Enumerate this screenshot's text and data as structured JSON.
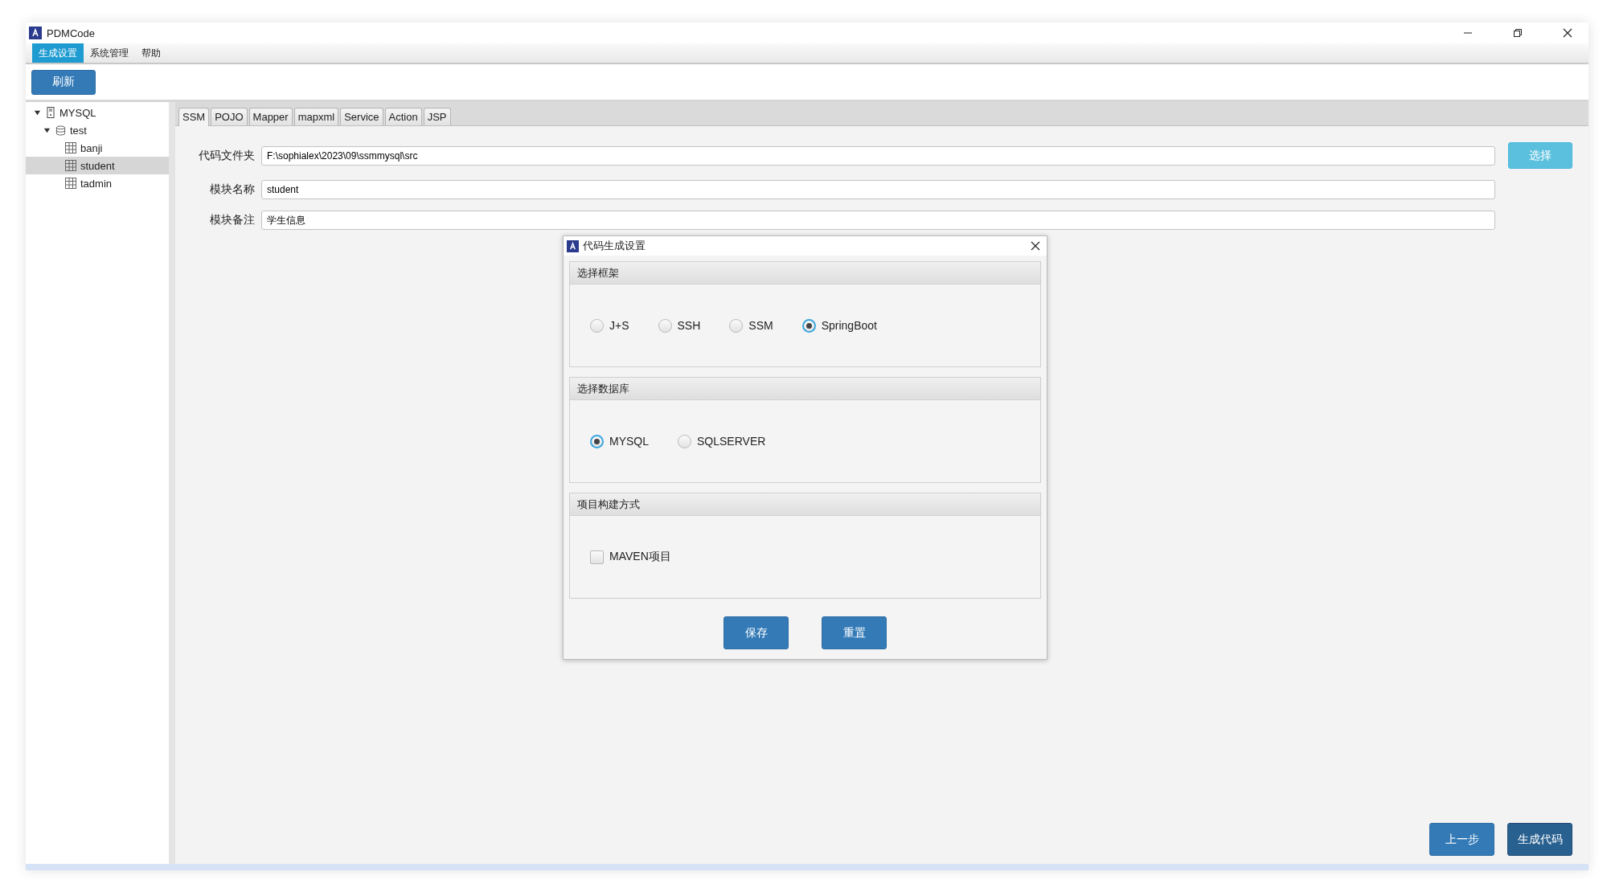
{
  "window": {
    "title": "PDMCode"
  },
  "menu": [
    {
      "label": "生成设置",
      "selected": true
    },
    {
      "label": "系统管理",
      "selected": false
    },
    {
      "label": "帮助",
      "selected": false
    }
  ],
  "toolbar": {
    "refresh_button": "刷新"
  },
  "tree": [
    {
      "label": "MYSQL",
      "kind": "server",
      "expanded": true,
      "selected": false,
      "children": [
        {
          "label": "test",
          "kind": "database",
          "expanded": true,
          "selected": false,
          "children": [
            {
              "label": "banji",
              "kind": "table",
              "selected": false
            },
            {
              "label": "student",
              "kind": "table",
              "selected": true
            },
            {
              "label": "tadmin",
              "kind": "table",
              "selected": false
            }
          ]
        }
      ]
    }
  ],
  "tabs": [
    {
      "label": "SSM",
      "selected": true
    },
    {
      "label": "POJO",
      "selected": false
    },
    {
      "label": "Mapper",
      "selected": false
    },
    {
      "label": "mapxml",
      "selected": false
    },
    {
      "label": "Service",
      "selected": false
    },
    {
      "label": "Action",
      "selected": false
    },
    {
      "label": "JSP",
      "selected": false
    }
  ],
  "form": {
    "fields": [
      {
        "label": "代码文件夹",
        "value": "F:\\sophialex\\2023\\09\\ssmmysql\\src"
      },
      {
        "label": "模块名称",
        "value": "student"
      },
      {
        "label": "模块备注",
        "value": "学生信息"
      }
    ],
    "choose_button": "选择"
  },
  "dialog": {
    "title": "代码生成设置",
    "sections": [
      {
        "title": "选择框架",
        "kind": "radio",
        "options": [
          {
            "label": "J+S",
            "selected": false
          },
          {
            "label": "SSH",
            "selected": false
          },
          {
            "label": "SSM",
            "selected": false
          },
          {
            "label": "SpringBoot",
            "selected": true
          }
        ]
      },
      {
        "title": "选择数据库",
        "kind": "radio",
        "options": [
          {
            "label": "MYSQL",
            "selected": true
          },
          {
            "label": "SQLSERVER",
            "selected": false
          }
        ]
      },
      {
        "title": "项目构建方式",
        "kind": "checkbox",
        "options": [
          {
            "label": "MAVEN项目",
            "checked": false
          }
        ]
      }
    ],
    "buttons": [
      "保存",
      "重置"
    ]
  },
  "footer_buttons": [
    {
      "label": "上一步",
      "kind": "normal"
    },
    {
      "label": "生成代码",
      "kind": "primary"
    }
  ]
}
